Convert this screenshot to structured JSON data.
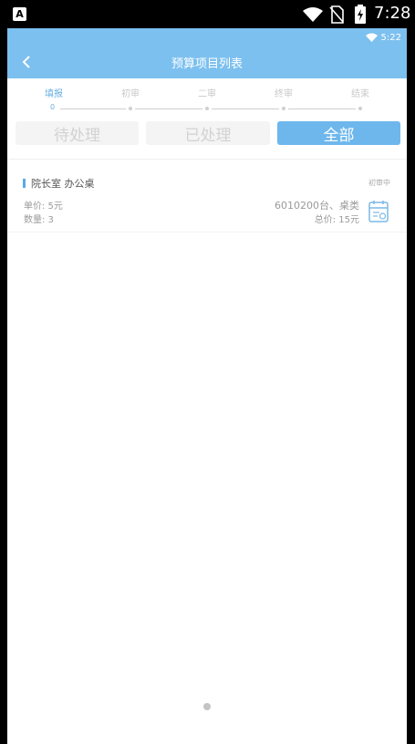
{
  "system_status": {
    "time": "7:28"
  },
  "app_status": {
    "time": "5:22"
  },
  "header": {
    "title": "预算项目列表"
  },
  "steps": [
    {
      "label": "填报",
      "active": true
    },
    {
      "label": "初审",
      "active": false
    },
    {
      "label": "二审",
      "active": false
    },
    {
      "label": "终审",
      "active": false
    },
    {
      "label": "结束",
      "active": false
    }
  ],
  "current_step_number": "0",
  "tabs": [
    {
      "label": "待处理",
      "active": false
    },
    {
      "label": "已处理",
      "active": false
    },
    {
      "label": "全部",
      "active": true
    }
  ],
  "items": [
    {
      "name": "院长室 办公桌",
      "status": "初审中",
      "unit_price": "单价: 5元",
      "quantity": "数量: 3",
      "code": "6010200台、桌类",
      "total": "总价: 15元"
    }
  ],
  "colors": {
    "header": "#7cc0ef",
    "accent": "#6db7ec",
    "active_step": "#6aaee0"
  },
  "icons": [
    "back-arrow-icon",
    "wifi-icon",
    "sim-off-icon",
    "battery-charging-icon",
    "calendar-icon"
  ]
}
